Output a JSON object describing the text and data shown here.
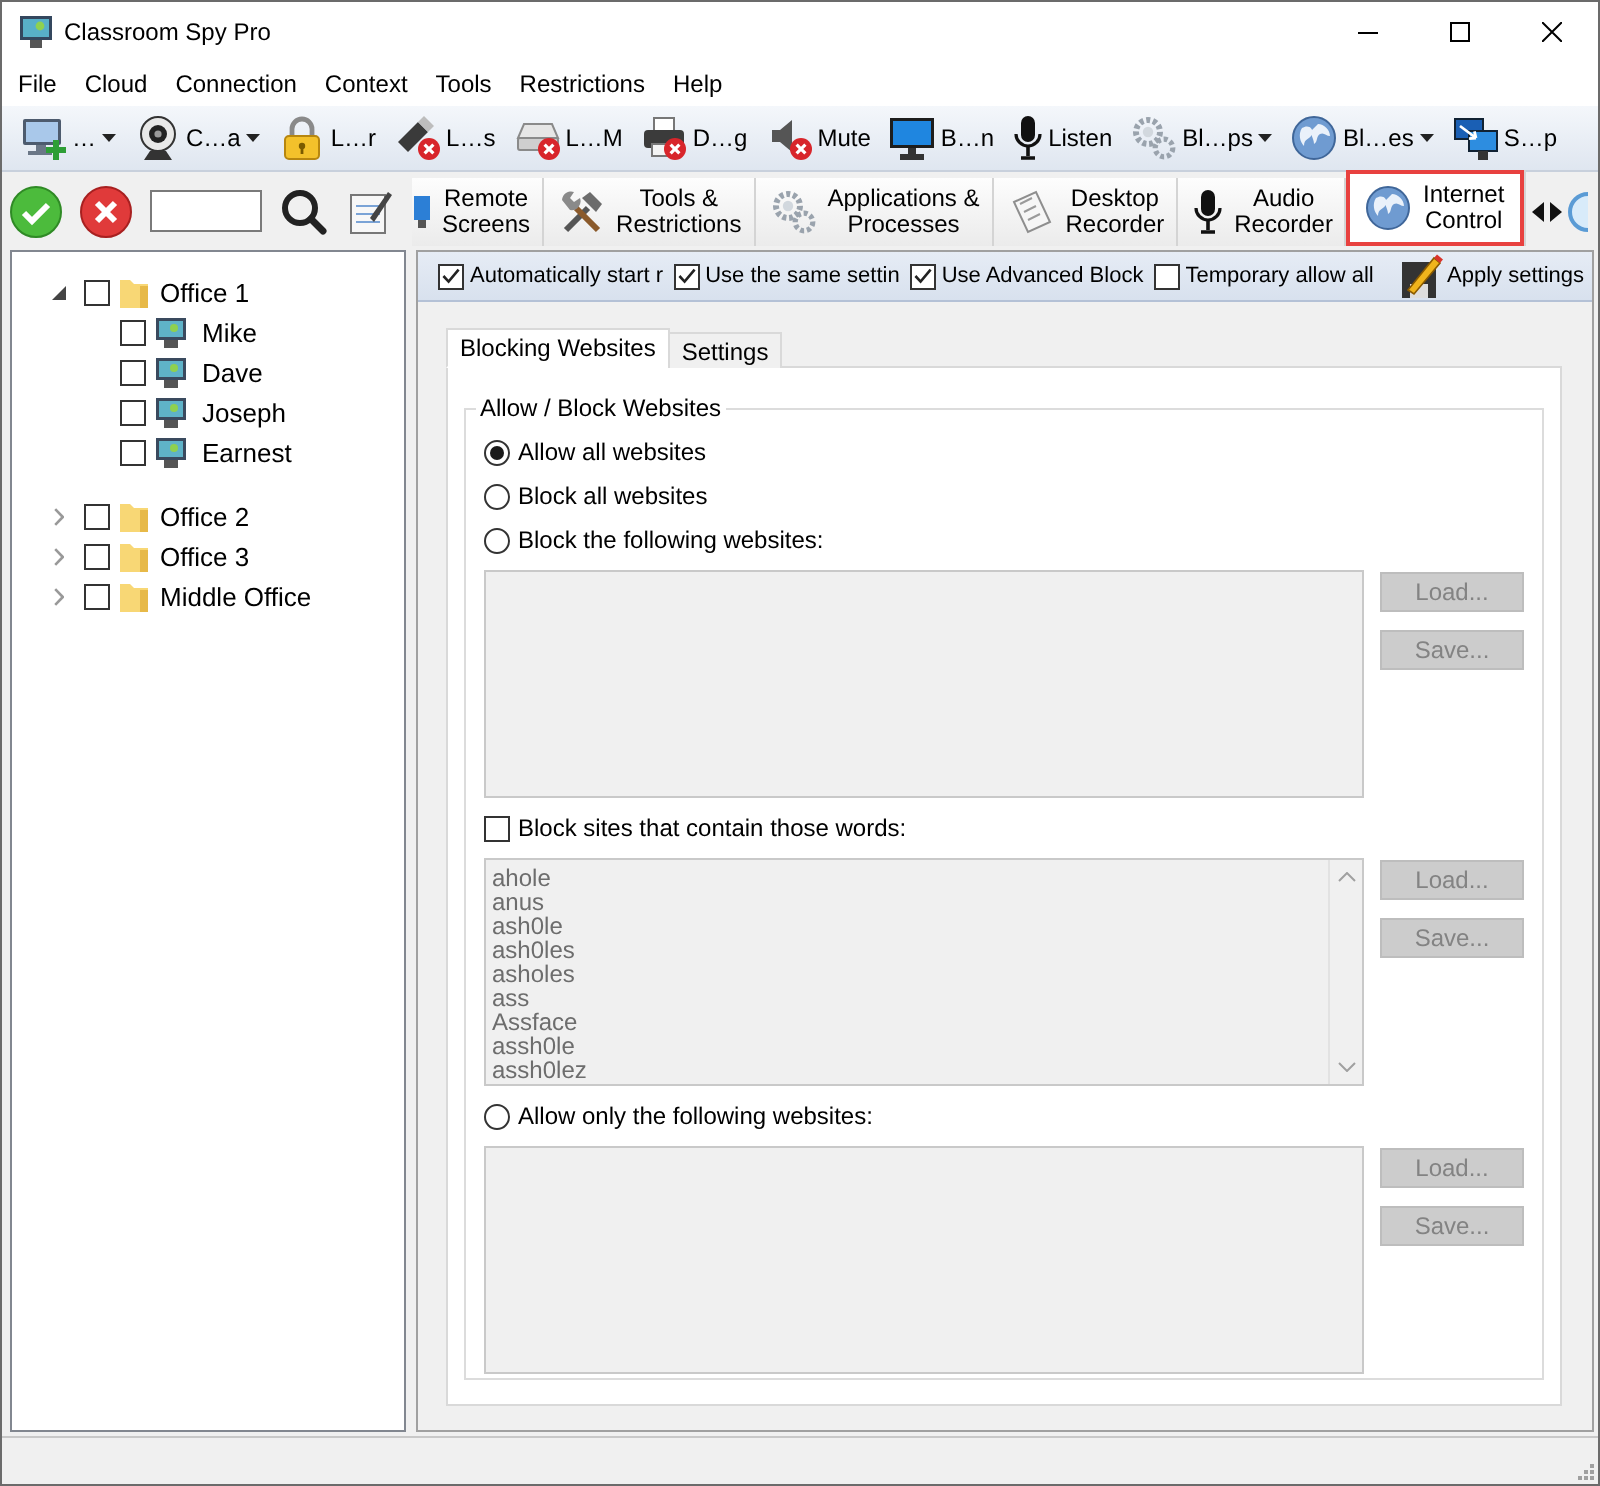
{
  "window": {
    "title": "Classroom Spy Pro"
  },
  "menu": [
    "File",
    "Cloud",
    "Connection",
    "Context",
    "Tools",
    "Restrictions",
    "Help"
  ],
  "toolbar": [
    {
      "label": "…",
      "dropdown": true
    },
    {
      "label": "C…a",
      "dropdown": true
    },
    {
      "label": "L…r",
      "dropdown": false
    },
    {
      "label": "L…s",
      "dropdown": false
    },
    {
      "label": "L…M",
      "dropdown": false
    },
    {
      "label": "D…g",
      "dropdown": false
    },
    {
      "label": "Mute",
      "dropdown": false
    },
    {
      "label": "B…n",
      "dropdown": false
    },
    {
      "label": "Listen",
      "dropdown": false
    },
    {
      "label": "Bl…ps",
      "dropdown": true
    },
    {
      "label": "Bl…es",
      "dropdown": true
    },
    {
      "label": "S…p",
      "dropdown": false
    }
  ],
  "tree": [
    {
      "label": "Office 1",
      "kind": "group",
      "expanded": true,
      "checked": false,
      "children": [
        {
          "label": "Mike",
          "kind": "computer",
          "checked": false
        },
        {
          "label": "Dave",
          "kind": "computer",
          "checked": false
        },
        {
          "label": "Joseph",
          "kind": "computer",
          "checked": false
        },
        {
          "label": "Earnest",
          "kind": "computer",
          "checked": false
        }
      ]
    },
    {
      "label": "Office 2",
      "kind": "group",
      "expanded": false,
      "checked": false
    },
    {
      "label": "Office 3",
      "kind": "group",
      "expanded": false,
      "checked": false
    },
    {
      "label": "Middle Office",
      "kind": "group",
      "expanded": false,
      "checked": false
    }
  ],
  "tabs": [
    {
      "lines": [
        "Remote",
        "Screens"
      ],
      "selected": false,
      "highlighted": false
    },
    {
      "lines": [
        "Tools &",
        "Restrictions"
      ],
      "selected": false,
      "highlighted": false
    },
    {
      "lines": [
        "Applications &",
        "Processes"
      ],
      "selected": false,
      "highlighted": false
    },
    {
      "lines": [
        "Desktop",
        "Recorder"
      ],
      "selected": false,
      "highlighted": false
    },
    {
      "lines": [
        "Audio",
        "Recorder"
      ],
      "selected": false,
      "highlighted": false
    },
    {
      "lines": [
        "Internet",
        "Control"
      ],
      "selected": true,
      "highlighted": true
    }
  ],
  "options_bar": {
    "checkboxes": [
      {
        "label": "Automatically start r",
        "checked": true
      },
      {
        "label": "Use the same settin",
        "checked": true
      },
      {
        "label": "Use Advanced Block",
        "checked": true
      },
      {
        "label": "Temporary allow all",
        "checked": false
      }
    ],
    "apply_button": "Apply settings"
  },
  "sub_tabs": [
    {
      "label": "Blocking Websites",
      "selected": true
    },
    {
      "label": "Settings",
      "selected": false
    }
  ],
  "group": {
    "title": "Allow / Block Websites",
    "options": [
      {
        "kind": "radio",
        "label": "Allow all websites",
        "selected": true
      },
      {
        "kind": "radio",
        "label": "Block all websites",
        "selected": false
      },
      {
        "kind": "radio",
        "label": "Block the following websites:",
        "selected": false,
        "list": {
          "disabled": true
        },
        "buttons": [
          {
            "label": "Load...",
            "disabled": true
          },
          {
            "label": "Save...",
            "disabled": true
          }
        ]
      },
      {
        "kind": "checkbox",
        "label": "Block sites that contain those words:",
        "checked": false,
        "list": {
          "disabled": true,
          "entries": [
            "ahole",
            "anus",
            "ash0le",
            "ash0les",
            "asholes",
            "ass",
            "Assface",
            "assh0le",
            "assh0lez"
          ]
        },
        "buttons": [
          {
            "label": "Load...",
            "disabled": true
          },
          {
            "label": "Save...",
            "disabled": true
          }
        ]
      },
      {
        "kind": "radio",
        "label": "Allow only the following websites:",
        "selected": false,
        "list": {
          "disabled": true
        },
        "buttons": [
          {
            "label": "Load...",
            "disabled": true
          },
          {
            "label": "Save...",
            "disabled": true
          }
        ]
      }
    ]
  }
}
